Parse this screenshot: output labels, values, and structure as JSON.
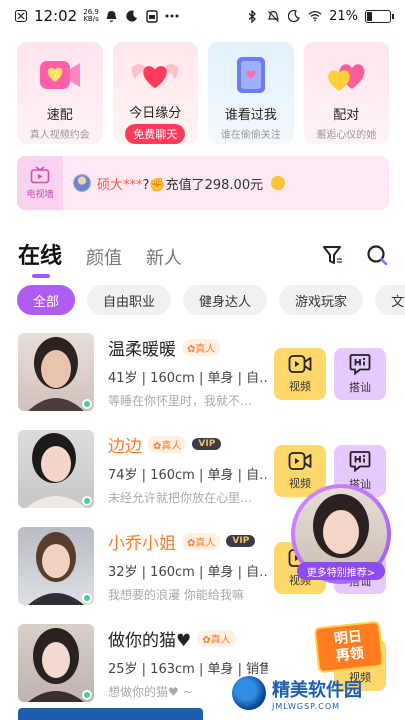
{
  "status_bar": {
    "time": "12:02",
    "net_speed": "26.9",
    "net_unit": "KB/s",
    "battery": "21%"
  },
  "features": [
    {
      "title": "速配",
      "subtitle": "真人视频约会",
      "icon": "heart-video-icon"
    },
    {
      "title": "今日缘分",
      "badge": "免费聊天",
      "icon": "winged-heart-icon"
    },
    {
      "title": "谁看过我",
      "subtitle": "谁在偷偷关注",
      "icon": "profile-card-icon"
    },
    {
      "title": "配对",
      "subtitle": "邂逅心仪的她",
      "icon": "double-heart-icon"
    }
  ],
  "banner": {
    "tv_label": "电视墙",
    "user": "硕大***",
    "message": "?✊充值了298.00元"
  },
  "tabs": [
    {
      "label": "在线",
      "active": true
    },
    {
      "label": "颜值",
      "active": false
    },
    {
      "label": "新人",
      "active": false
    }
  ],
  "chips": [
    {
      "label": "全部",
      "active": true
    },
    {
      "label": "自由职业",
      "active": false
    },
    {
      "label": "健身达人",
      "active": false
    },
    {
      "label": "游戏玩家",
      "active": false
    },
    {
      "label": "文艺",
      "active": false
    }
  ],
  "actions": {
    "video_label": "视频",
    "hi_label": "搭讪"
  },
  "users": [
    {
      "name": "温柔暖暖",
      "real": "真人",
      "vip": "",
      "meta": "41岁 | 160cm | 单身 | 自…",
      "signature": "等睡在你怀里时，我就不…"
    },
    {
      "name": "边边",
      "real": "真人",
      "vip": "VIP",
      "meta": "74岁 | 160cm | 单身 | 自…",
      "signature": "未经允许就把你放在心里…"
    },
    {
      "name": "小乔小姐",
      "real": "真人",
      "vip": "VIP",
      "meta": "32岁 | 160cm | 单身 | 自…",
      "signature": "我想要的浪漫 你能给我嘛"
    },
    {
      "name": "做你的猫♥",
      "real": "真人",
      "vip": "",
      "meta": "25岁 | 163cm | 单身 | 销售",
      "signature": "想做你的猫♥ ~"
    }
  ],
  "recommend_label": "更多特别推荐>",
  "promo": {
    "line1": "明日",
    "line2": "再领"
  },
  "watermark": {
    "name": "精美软件园",
    "site": "JMLWGSP.COM"
  },
  "colors": {
    "accent": "#b05cf0",
    "orange": "#ff7a2a",
    "video_btn": "#ffd86b",
    "hi_btn": "#e6c9ff"
  }
}
